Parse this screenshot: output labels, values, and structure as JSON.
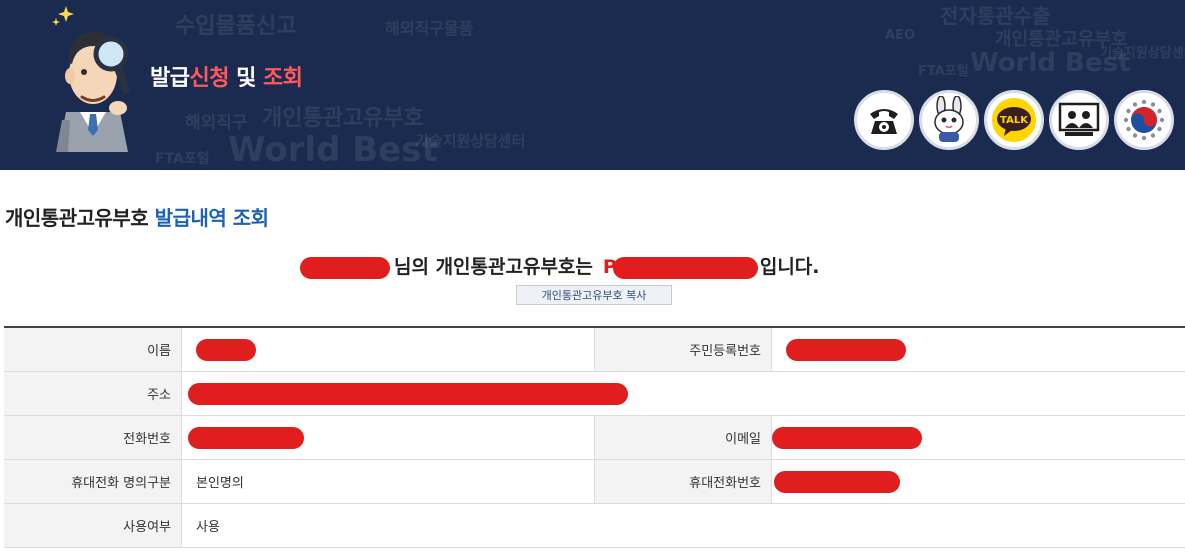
{
  "banner": {
    "title_part1": "발급",
    "title_part2": "신청",
    "title_part3": " 및 ",
    "title_part4": "조회",
    "background_words": [
      "수입물품신고",
      "해외직구물품",
      "전자통관수출",
      "개인통관고유부호",
      "World Best",
      "FTA포털",
      "기술지원상담센터",
      "AEO",
      "해외직구",
      "개인통관고유부호",
      "World Best",
      "FTA포털",
      "기술지원상담센터"
    ],
    "quick_icons": [
      {
        "name": "telephone-icon",
        "desc": "phone"
      },
      {
        "name": "mascot-chat-icon",
        "desc": "mascot"
      },
      {
        "name": "kakao-talk-icon",
        "label": "TALK"
      },
      {
        "name": "video-consult-icon",
        "desc": "video"
      },
      {
        "name": "korea-emblem-icon",
        "desc": "emblem"
      }
    ]
  },
  "section": {
    "title_prefix": "개인통관고유부호",
    "title_suffix": "발급내역 조회"
  },
  "result": {
    "name_suffix": "님의 개인통관고유부호는",
    "code_prefix": "P",
    "end_text": "입니다."
  },
  "copy_button": {
    "label": "개인통관고유부호 복사"
  },
  "table": {
    "name_label": "이름",
    "rrn_label": "주민등록번호",
    "address_label": "주소",
    "phone_label": "전화번호",
    "email_label": "이메일",
    "mobile_owner_label": "휴대전화 명의구분",
    "mobile_owner_value": "본인명의",
    "mobile_label": "휴대전화번호",
    "usage_label": "사용여부",
    "usage_value": "사용"
  },
  "colors": {
    "banner_bg": "#1a2b4f",
    "highlight_red": "#ff5a5a",
    "accent_blue": "#1e62b4",
    "redaction_red": "#e01e1e"
  }
}
